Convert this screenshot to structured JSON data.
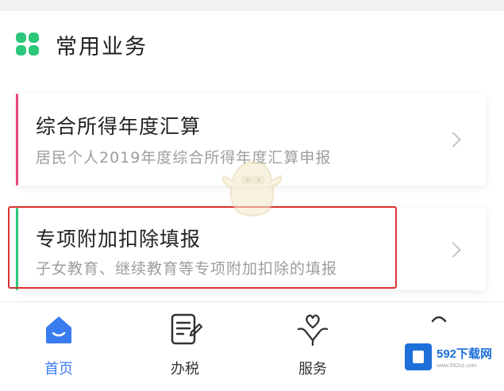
{
  "section": {
    "title": "常用业务",
    "icon": "grid-apps-icon",
    "accent": "#2bc77b"
  },
  "cards": [
    {
      "title": "综合所得年度汇算",
      "subtitle": "居民个人2019年度综合所得年度汇算申报",
      "accent": "#e8447a"
    },
    {
      "title": "专项附加扣除填报",
      "subtitle": "子女教育、继续教育等专项附加扣除的填报",
      "accent": "#2bc77b"
    }
  ],
  "highlight_color": "#d9322f",
  "tabbar": {
    "items": [
      {
        "label": "首页",
        "icon": "home-icon",
        "active": true
      },
      {
        "label": "办税",
        "icon": "document-edit-icon",
        "active": false
      },
      {
        "label": "服务",
        "icon": "heart-hand-icon",
        "active": false
      },
      {
        "label": "",
        "icon": "profile-icon",
        "active": false
      }
    ],
    "active_color": "#3a7bf0"
  },
  "watermark": {
    "brand": "592下载网",
    "url": "www.592xz.com"
  }
}
